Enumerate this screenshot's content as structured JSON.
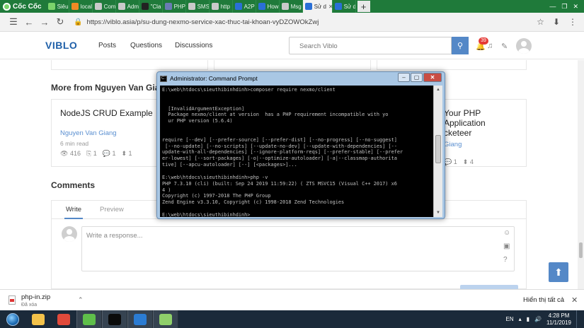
{
  "browser": {
    "brand": "Cốc Cốc",
    "tabs": [
      {
        "label": "Siêu",
        "icon": "coccoc-icon",
        "color": "#7bd36b"
      },
      {
        "label": "local",
        "icon": "localhost-icon",
        "color": "#f08a24"
      },
      {
        "label": "Com",
        "icon": "page-icon",
        "color": "#c9c9c9"
      },
      {
        "label": "Adm",
        "icon": "admin-icon",
        "color": "#c9c9c9"
      },
      {
        "label": "\"Cla",
        "icon": "github-icon",
        "color": "#222222"
      },
      {
        "label": "PHP",
        "icon": "php-icon",
        "color": "#6a7bb4"
      },
      {
        "label": "SMS",
        "icon": "sms-icon",
        "color": "#c9c9c9"
      },
      {
        "label": "http",
        "icon": "mail-icon",
        "color": "#c9c9c9"
      },
      {
        "label": "A2P",
        "icon": "nexmo-icon",
        "color": "#2a6fd6"
      },
      {
        "label": "How",
        "icon": "nexmo-icon",
        "color": "#2a6fd6"
      },
      {
        "label": "Msg",
        "icon": "mail-icon",
        "color": "#c9c9c9"
      },
      {
        "label": "Sử d",
        "icon": "viblo-icon",
        "color": "#2a6fd6",
        "active": true
      },
      {
        "label": "Sử d",
        "icon": "viblo-icon",
        "color": "#2a6fd6"
      }
    ],
    "url": "https://viblo.asia/p/su-dung-nexmo-service-xac-thuc-tai-khoan-vyDZOWOkZwj"
  },
  "site": {
    "logo": "VIBLO",
    "nav": [
      "Posts",
      "Questions",
      "Discussions"
    ],
    "search_placeholder": "Search Viblo",
    "notification_count": "39"
  },
  "more_section": {
    "title": "More from Nguyen Van Giang",
    "cards": [
      {
        "title": "NodeJS CRUD Example",
        "author": "Nguyen Van Giang",
        "read_time": "6 min read",
        "views": "416",
        "clips": "1",
        "comments": "1",
        "votes": "1"
      },
      {
        "title": "Your PHP Application",
        "title2": "cketeer",
        "author": "Giang",
        "views": "",
        "clips": "",
        "comments": "1",
        "votes": "4"
      }
    ]
  },
  "comments": {
    "title": "Comments",
    "tab_write": "Write",
    "tab_preview": "Preview",
    "placeholder": "Write a response..."
  },
  "cmd": {
    "title": "Administrator: Command Prompt",
    "lines": [
      "E:\\web\\htdocs\\sieuthibinhdinh>composer require nexmo/client",
      "",
      "",
      "  [InvalidArgumentException]",
      "  Package nexmo/client at version  has a PHP requirement incompatible with yo",
      "  ur PHP version (5.6.4)",
      "",
      "",
      "require [--dev] [--prefer-source] [--prefer-dist] [--no-progress] [--no-suggest]",
      " [--no-update] [--no-scripts] [--update-no-dev] [--update-with-dependencies] [--",
      "update-with-all-dependencies] [--ignore-platform-reqs] [--prefer-stable] [--prefer",
      "er-lowest] [--sort-packages] [-o|--optimize-autoloader] [-a|--classmap-authorita",
      "tive] [--apcu-autoloader] [--] [<packages>]...",
      "",
      "E:\\web\\htdocs\\sieuthibinhdinh>php -v",
      "PHP 7.3.10 (cli) (built: Sep 24 2019 11:59:22) ( ZTS MSVC15 (Visual C++ 2017) x6",
      "4 )",
      "Copyright (c) 1997-2018 The PHP Group",
      "Zend Engine v3.3.10, Copyright (c) 1998-2018 Zend Technologies",
      "",
      "E:\\web\\htdocs\\sieuthibinhdinh>_"
    ]
  },
  "download": {
    "filename": "php-in.zip",
    "status": "Đã xóa",
    "show_all": "Hiển thị tất cả"
  },
  "taskbar": {
    "apps": [
      {
        "name": "explorer-app",
        "color": "#f3c24a",
        "open": false
      },
      {
        "name": "chrome-app",
        "color": "#e04a3b",
        "open": false
      },
      {
        "name": "coccoc-app",
        "color": "#5fbf4a",
        "open": true
      },
      {
        "name": "cmd-app",
        "color": "#0b0b0b",
        "open": true
      },
      {
        "name": "vscode-app",
        "color": "#2b7cd3",
        "open": true
      },
      {
        "name": "notepad-app",
        "color": "#8fcf6a",
        "open": true
      }
    ],
    "lang": "EN",
    "time": "4:28 PM",
    "date": "11/1/2019"
  }
}
